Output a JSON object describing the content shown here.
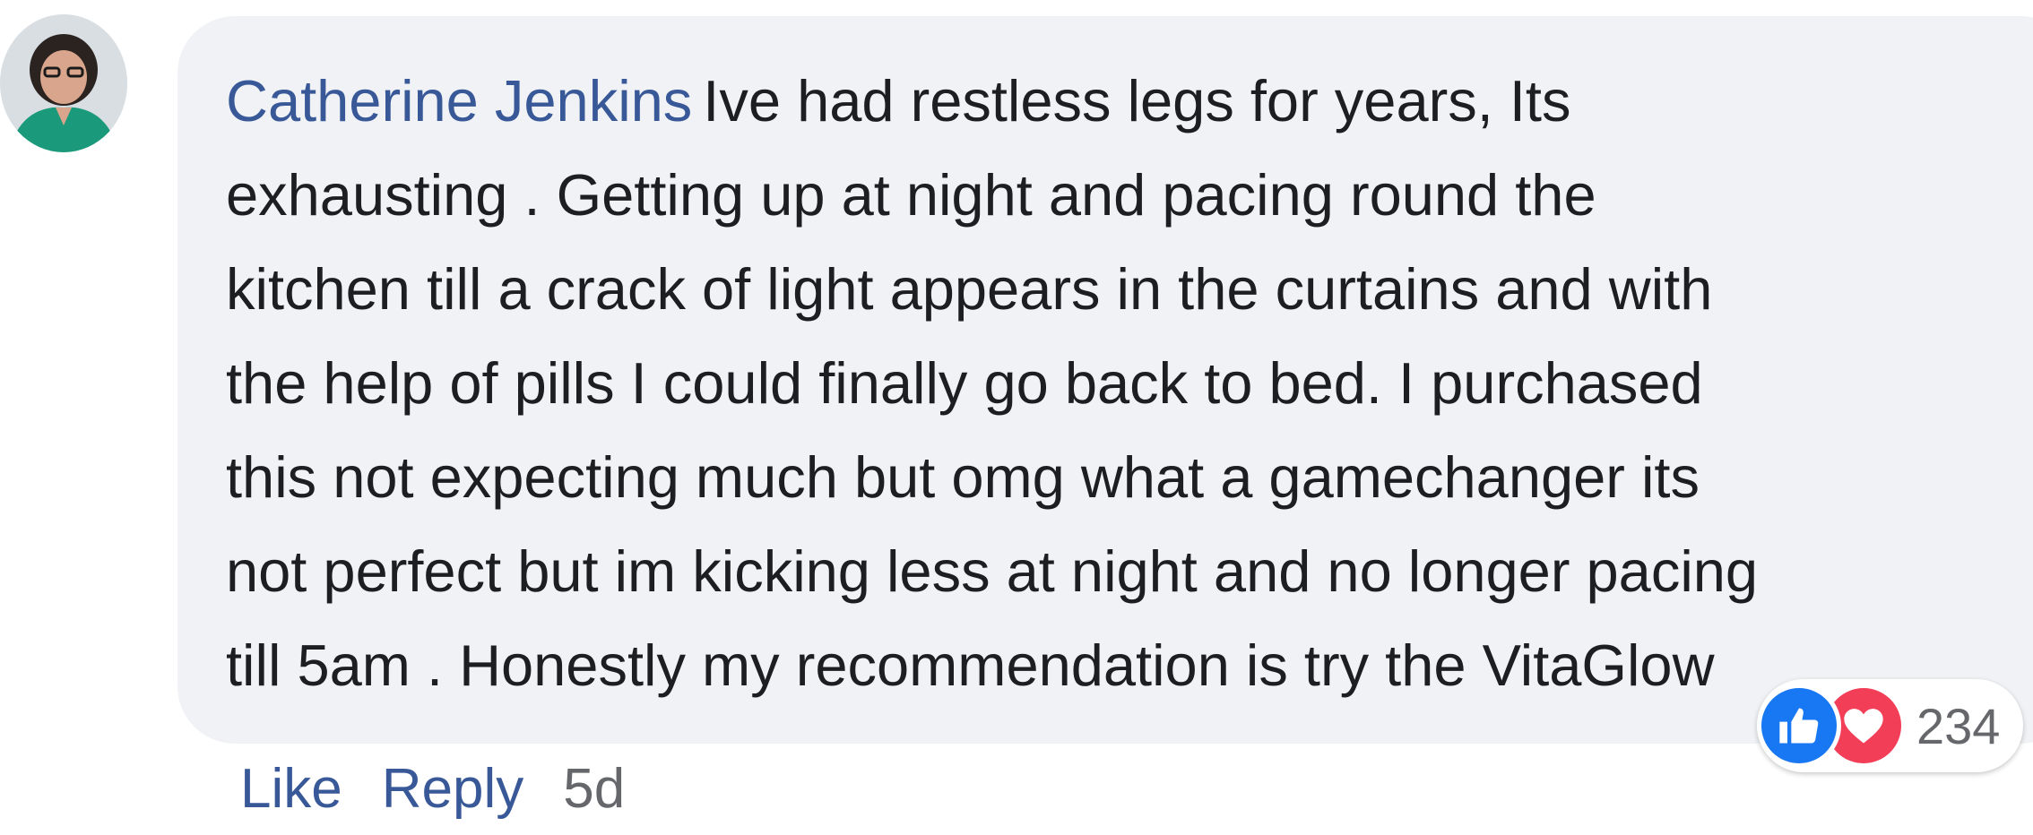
{
  "comment": {
    "author": "Catherine Jenkins",
    "lines": [
      "Ive had restless legs for years, Its",
      "exhausting . Getting up at night and pacing round the",
      "kitchen till a crack of light appears in the curtains and with",
      "the help of pills I could finally go back to bed. I purchased",
      "this not expecting much but omg what a gamechanger its",
      "not perfect but im kicking less at night and no longer pacing",
      "till 5am . Honestly my recommendation is try the VitaGlow"
    ]
  },
  "reactions": {
    "icons": [
      "thumbs-up-icon",
      "heart-icon"
    ],
    "count": "234"
  },
  "actions": {
    "like_label": "Like",
    "reply_label": "Reply",
    "timestamp": "5d"
  },
  "colors": {
    "author": "#385898",
    "bubble": "#f0f2f5",
    "like_reaction": "#1877f2",
    "love_reaction": "#f33e58"
  }
}
